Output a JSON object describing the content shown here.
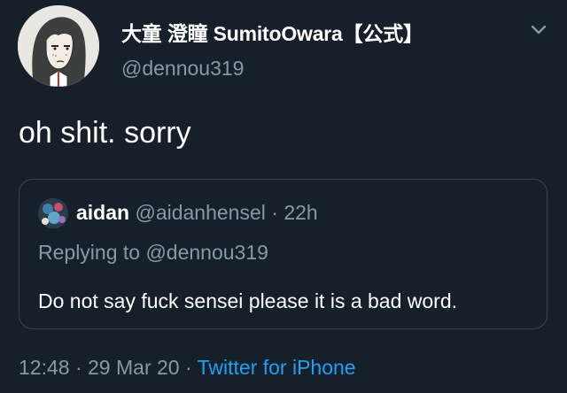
{
  "author": {
    "display_name": "大童 澄瞳 SumitoOwara【公式】",
    "handle": "@dennou319",
    "avatar_icon": "avatar-illustration-icon"
  },
  "tweet": {
    "text": "oh shit. sorry"
  },
  "quoted": {
    "name": "aidan",
    "handle": "@aidanhensel",
    "separator": "·",
    "age": "22h",
    "replying_to": "Replying to @dennou319",
    "text": "Do not say fuck sensei please it is a bad word."
  },
  "footer": {
    "time": "12:48",
    "separator1": "·",
    "date": "29 Mar 20",
    "separator2": "·",
    "source": "Twitter for iPhone"
  },
  "colors": {
    "background": "#15202b",
    "secondary_text": "#8899a6",
    "link": "#1da1f2",
    "border": "#38444d"
  }
}
